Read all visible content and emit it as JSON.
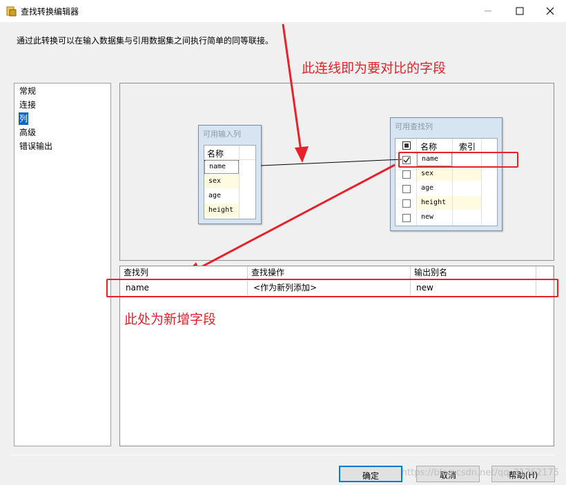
{
  "window": {
    "title": "查找转换编辑器"
  },
  "description": "通过此转换可以在输入数据集与引用数据集之间执行简单的同等联接。",
  "nav": {
    "items": [
      "常规",
      "连接",
      "列",
      "高级",
      "错误输出"
    ],
    "selected": "列"
  },
  "input_columns": {
    "title": "可用输入列",
    "header": "名称",
    "rows": [
      "name",
      "sex",
      "age",
      "height"
    ]
  },
  "lookup_columns": {
    "title": "可用查找列",
    "header_name": "名称",
    "header_index": "索引",
    "rows": [
      {
        "name": "name",
        "checked": true
      },
      {
        "name": "sex",
        "checked": false
      },
      {
        "name": "age",
        "checked": false
      },
      {
        "name": "height",
        "checked": false
      },
      {
        "name": "new",
        "checked": false
      }
    ]
  },
  "grid": {
    "headers": [
      "查找列",
      "查找操作",
      "输出别名"
    ],
    "rows": [
      [
        "name",
        "<作为新列添加>",
        "new"
      ]
    ]
  },
  "annotations": {
    "top": "此连线即为要对比的字段",
    "bottom": "此处为新增字段"
  },
  "buttons": {
    "ok": "确定",
    "cancel": "取消",
    "help": "帮助(H)"
  },
  "watermark": "https://blog.csdn.net/qq_31362175",
  "colors": {
    "annotation": "#e8202a",
    "selection": "#0a64c9",
    "focus": "#0078d7"
  }
}
